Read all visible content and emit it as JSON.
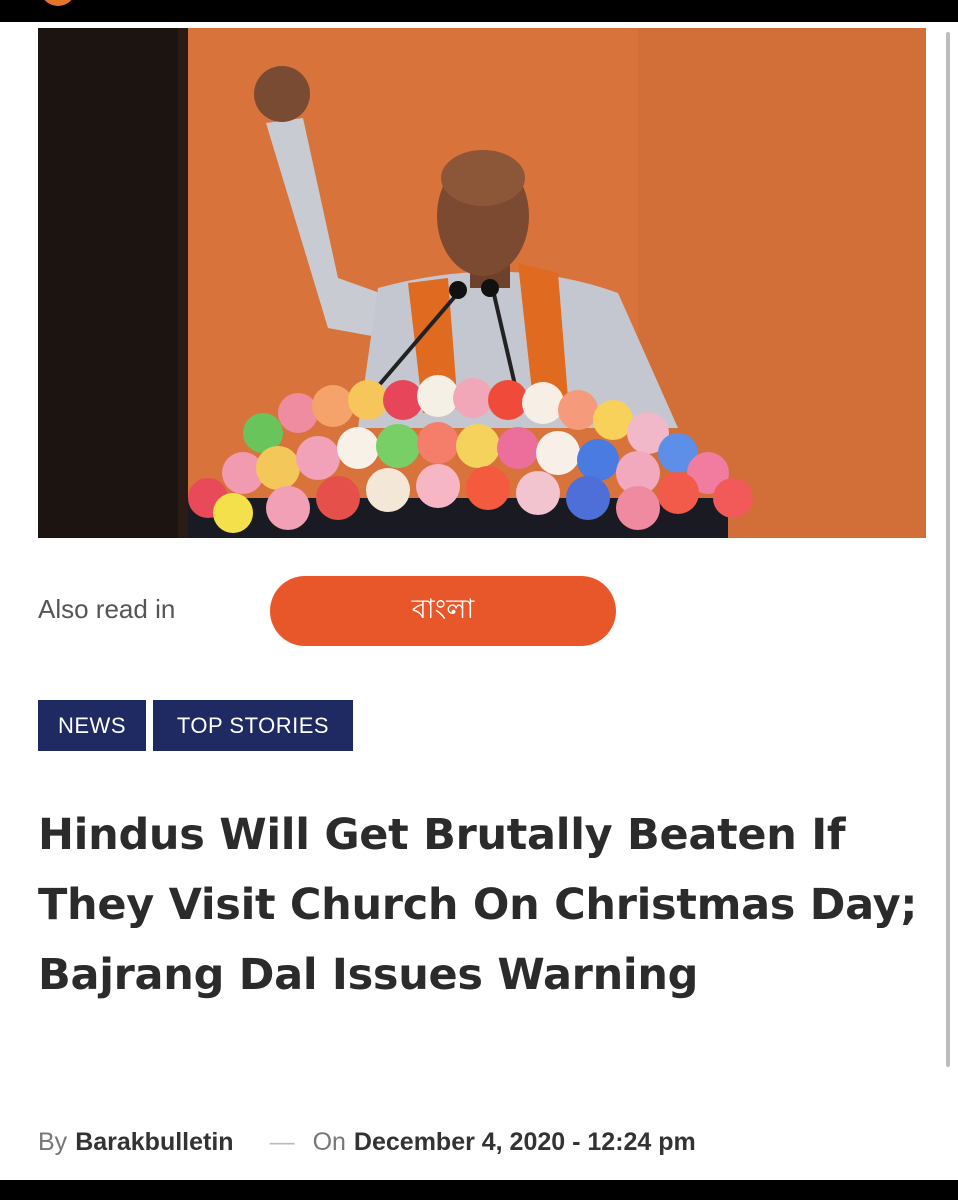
{
  "also_read": {
    "label": "Also read in",
    "language_button": "বাংলা"
  },
  "categories": [
    "NEWS",
    "TOP STORIES"
  ],
  "headline": "Hindus Will Get Brutally Beaten If They Visit Church On Christmas Day; Bajrang Dal Issues Warning",
  "byline": {
    "by_label": "By",
    "author": "Barakbulletin",
    "separator": "—",
    "on_label": "On",
    "date": "December 4, 2020 - 12:24 pm"
  },
  "colors": {
    "accent_orange": "#e8572a",
    "tag_navy": "#1f2a63",
    "headline_text": "#2b2b2b"
  }
}
